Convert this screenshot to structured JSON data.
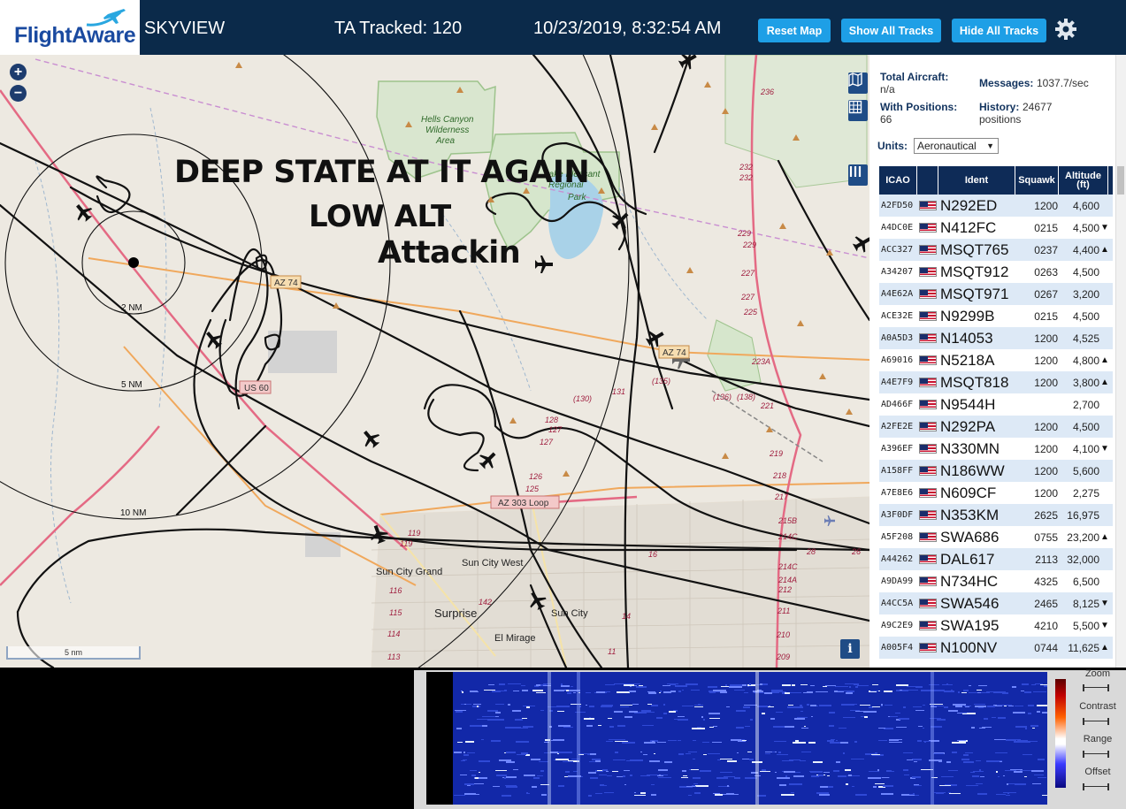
{
  "header": {
    "logo": "FlightAware",
    "app_name": "SKYVIEW",
    "tracked": "TA Tracked: 120",
    "datetime": "10/23/2019, 8:32:54 AM",
    "buttons": {
      "reset": "Reset Map",
      "show": "Show All Tracks",
      "hide": "Hide All Tracks"
    }
  },
  "map": {
    "overlay_lines": [
      "DEEP STATE AT IT AGAIN",
      "LOW ALT",
      "Attackin"
    ],
    "zoom_in": "+",
    "zoom_out": "−",
    "scale": "5 nm",
    "info": "i",
    "range_rings": [
      "2 NM",
      "5 NM",
      "10 NM"
    ],
    "places": [
      "Hells Canyon",
      "Wilderness",
      "Area",
      "Lake Pleasant",
      "Regional",
      "Park",
      "Sun City West",
      "Sun City Grand",
      "Surprise",
      "Sun City",
      "El Mirage"
    ],
    "road_shields": [
      "AZ 74",
      "US 60",
      "AZ 74",
      "AZ 303 Loop"
    ],
    "road_numbers": [
      "236",
      "232",
      "232",
      "229",
      "229",
      "227",
      "227",
      "225",
      "223A",
      "221",
      "219",
      "218",
      "217",
      "215B",
      "214C",
      "214C",
      "214A",
      "212",
      "211",
      "210",
      "209",
      "119",
      "119",
      "116",
      "115",
      "114",
      "113",
      "142",
      "128",
      "127",
      "127",
      "126",
      "125",
      "(130)",
      "131",
      "(135)",
      "(136)",
      "(138)",
      "14",
      "11",
      "16",
      "26",
      "28"
    ]
  },
  "sidebar": {
    "total_label": "Total Aircraft:",
    "total_value": "n/a",
    "positions_label": "With Positions:",
    "positions_value": "66",
    "messages_label": "Messages:",
    "messages_value": "1037.7/sec",
    "history_label": "History:",
    "history_value": "24677",
    "history_unit": "positions",
    "units_label": "Units:",
    "units_value": "Aeronautical",
    "columns": {
      "icao": "ICAO",
      "ident": "Ident",
      "squawk": "Squawk",
      "altitude": "Altitude",
      "altitude_unit": "(ft)"
    },
    "rows": [
      {
        "icao": "A2FD50",
        "ident": "N292ED",
        "squawk": "1200",
        "alt": "4,600",
        "trend": ""
      },
      {
        "icao": "A4DC0E",
        "ident": "N412FC",
        "squawk": "0215",
        "alt": "4,500",
        "trend": "▼"
      },
      {
        "icao": "ACC327",
        "ident": "MSQT765",
        "squawk": "0237",
        "alt": "4,400",
        "trend": "▲"
      },
      {
        "icao": "A34207",
        "ident": "MSQT912",
        "squawk": "0263",
        "alt": "4,500",
        "trend": ""
      },
      {
        "icao": "A4E62A",
        "ident": "MSQT971",
        "squawk": "0267",
        "alt": "3,200",
        "trend": ""
      },
      {
        "icao": "ACE32E",
        "ident": "N9299B",
        "squawk": "0215",
        "alt": "4,500",
        "trend": ""
      },
      {
        "icao": "A0A5D3",
        "ident": "N14053",
        "squawk": "1200",
        "alt": "4,525",
        "trend": ""
      },
      {
        "icao": "A69016",
        "ident": "N5218A",
        "squawk": "1200",
        "alt": "4,800",
        "trend": "▲"
      },
      {
        "icao": "A4E7F9",
        "ident": "MSQT818",
        "squawk": "1200",
        "alt": "3,800",
        "trend": "▲"
      },
      {
        "icao": "AD466F",
        "ident": "N9544H",
        "squawk": "",
        "alt": "2,700",
        "trend": ""
      },
      {
        "icao": "A2FE2E",
        "ident": "N292PA",
        "squawk": "1200",
        "alt": "4,500",
        "trend": ""
      },
      {
        "icao": "A396EF",
        "ident": "N330MN",
        "squawk": "1200",
        "alt": "4,100",
        "trend": "▼"
      },
      {
        "icao": "A158FF",
        "ident": "N186WW",
        "squawk": "1200",
        "alt": "5,600",
        "trend": ""
      },
      {
        "icao": "A7E8E6",
        "ident": "N609CF",
        "squawk": "1200",
        "alt": "2,275",
        "trend": ""
      },
      {
        "icao": "A3F0DF",
        "ident": "N353KM",
        "squawk": "2625",
        "alt": "16,975",
        "trend": ""
      },
      {
        "icao": "A5F208",
        "ident": "SWA686",
        "squawk": "0755",
        "alt": "23,200",
        "trend": "▲"
      },
      {
        "icao": "A44262",
        "ident": "DAL617",
        "squawk": "2113",
        "alt": "32,000",
        "trend": ""
      },
      {
        "icao": "A9DA99",
        "ident": "N734HC",
        "squawk": "4325",
        "alt": "6,500",
        "trend": ""
      },
      {
        "icao": "A4CC5A",
        "ident": "SWA546",
        "squawk": "2465",
        "alt": "8,125",
        "trend": "▼"
      },
      {
        "icao": "A9C2E9",
        "ident": "SWA195",
        "squawk": "4210",
        "alt": "5,500",
        "trend": "▼"
      },
      {
        "icao": "A005F4",
        "ident": "N100NV",
        "squawk": "0744",
        "alt": "11,625",
        "trend": "▲"
      }
    ]
  },
  "spectrum": {
    "labels": {
      "zoom": "Zoom",
      "contrast": "Contrast",
      "range": "Range",
      "offset": "Offset"
    }
  },
  "colors": {
    "header": "#0b2a4a",
    "button": "#1e9fe6",
    "table_header": "#0e2b57",
    "row_alt": "#dde9f6",
    "track": "#111111",
    "waterfall": "#1228a8"
  }
}
